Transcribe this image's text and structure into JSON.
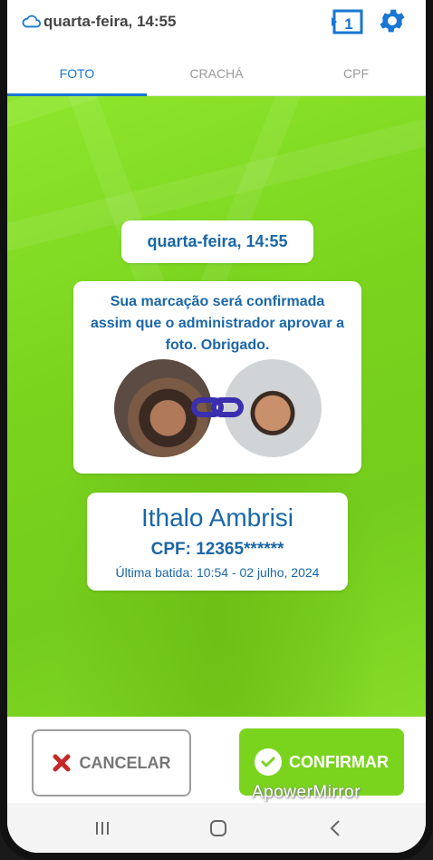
{
  "status": {
    "datetime": "quarta-feira, 14:55",
    "slides_badge": "1"
  },
  "tabs": [
    {
      "label": "FOTO",
      "active": true
    },
    {
      "label": "CRACHÁ",
      "active": false
    },
    {
      "label": "CPF",
      "active": false
    }
  ],
  "main": {
    "timestamp": "quarta-feira, 14:55",
    "message": "Sua marcação será confirmada assim que o administrador aprovar a foto. Obrigado.",
    "user": {
      "name": "Ithalo Ambrisi",
      "cpf": "CPF: 12365******",
      "last_punch": "Última batida: 10:54 - 02 julho, 2024"
    }
  },
  "footer": {
    "cancel_label": "CANCELAR",
    "confirm_label": "CONFIRMAR",
    "watermark": "ApowerMirror"
  },
  "icons": {
    "cloud": "cloud-icon",
    "slides": "slides-icon",
    "settings": "gear-icon",
    "link": "link-icon",
    "cancel": "x-icon",
    "confirm": "check-icon"
  },
  "colors": {
    "accent": "#1976d2",
    "text_blue": "#1a67a8",
    "green": "#7ad41e",
    "cancel_red": "#c62828"
  }
}
